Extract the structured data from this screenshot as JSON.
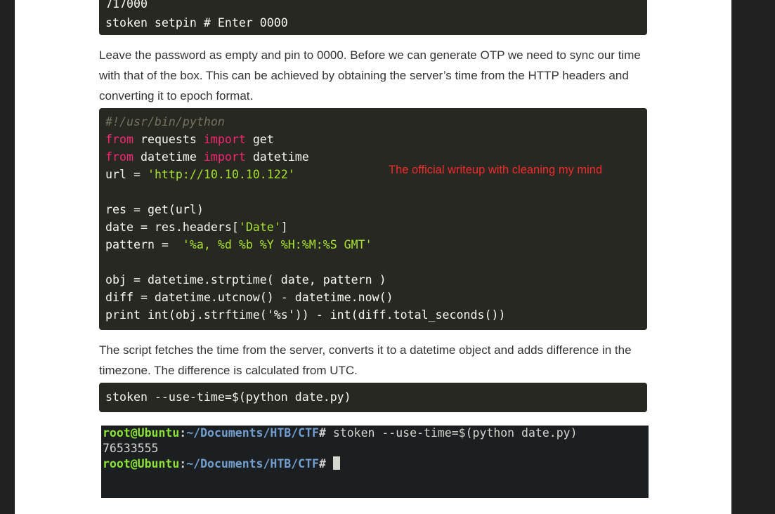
{
  "code_block_1": {
    "lines": [
      "717000",
      "stoken setpin # Enter 0000"
    ]
  },
  "paragraph_1": "Leave the password as empty and pin to 0000. Before we can generate OTP we need to sync our time with that of the box. This can be achieved by obtaining the server’s time from the HTTP headers and converting it to epoch format.",
  "code_block_2": {
    "shebang": "#!/usr/bin/python",
    "kw_from": "from",
    "kw_import": "import",
    "l2_mod": " requests ",
    "l2_name": " get",
    "l3_mod": " datetime ",
    "l3_name": " datetime",
    "l4_pre": "url = ",
    "l4_str": "'http://10.10.10.122'",
    "l6": "res = get(url)",
    "l7_pre": "date = res.headers[",
    "l7_str": "'Date'",
    "l7_post": "]",
    "l8_pre": "pattern =  ",
    "l8_str": "'%a, %d %b %Y %H:%M:%S GMT'",
    "l10": "obj = datetime.strptime( date, pattern )",
    "l11": "diff = datetime.utcnow() - datetime.now()",
    "l12": "print int(obj.strftime('%s')) - int(diff.total_seconds())"
  },
  "watermark": "The official writeup with cleaning my mind",
  "paragraph_2": "The script fetches the time from the server, converts it to a datetime object and adds difference in the timezone. The difference is calculated from UTC.",
  "code_block_3": {
    "line": "stoken --use-time=$(python date.py)"
  },
  "terminal": {
    "user_host": "root@Ubuntu",
    "sep": ":",
    "path": "~/Documents/HTB/CTF",
    "hash": "#",
    "command": " stoken --use-time=$(python date.py)",
    "output": "76533555"
  }
}
